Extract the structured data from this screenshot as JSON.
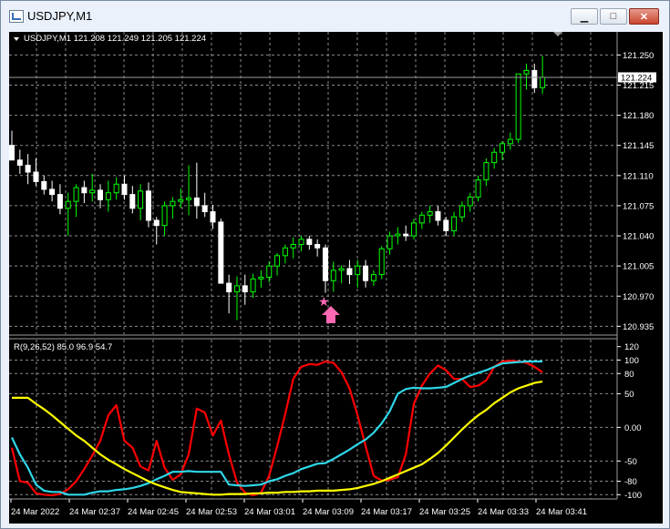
{
  "window": {
    "title": "USDJPY,M1",
    "minimize": "▁",
    "maximize": "□",
    "close": "✕"
  },
  "colors": {
    "background": "#000000",
    "grid": "#8a8a8a",
    "bull": "#00ff00",
    "bear": "#ffffff",
    "arrow": "#ff69b4",
    "red": "#ff0000",
    "cyan": "#2fd7e8",
    "yellow": "#ffff00",
    "currentPrice": "#ffffff"
  },
  "icons": {
    "collapse": "triangle-down-icon",
    "signal_star": "star-icon",
    "signal_arrow": "up-arrow-icon"
  },
  "main": {
    "header": "USDJPY,M1  121.208 121.249 121.205 121.224",
    "current_price": "121.224",
    "price_min": 120.928,
    "price_max": 121.262
  },
  "chart_data": [
    {
      "type": "candlestick",
      "price_ticks": [
        "121.250",
        "121.215",
        "121.180",
        "121.145",
        "121.110",
        "121.075",
        "121.040",
        "121.005",
        "120.970",
        "120.935"
      ],
      "candles": [
        [
          121.145,
          121.162,
          121.138,
          121.128
        ],
        [
          121.128,
          121.14,
          121.112,
          121.122
        ],
        [
          121.122,
          121.135,
          121.1,
          121.114
        ],
        [
          121.114,
          121.13,
          121.098,
          121.103
        ],
        [
          121.103,
          121.11,
          121.088,
          121.094
        ],
        [
          121.094,
          121.104,
          121.08,
          121.088
        ],
        [
          121.088,
          121.1,
          121.065,
          121.072
        ],
        [
          121.072,
          121.09,
          121.04,
          121.08
        ],
        [
          121.08,
          121.1,
          121.062,
          121.096
        ],
        [
          121.096,
          121.104,
          121.078,
          121.09
        ],
        [
          121.09,
          121.112,
          121.08,
          121.093
        ],
        [
          121.093,
          121.1,
          121.072,
          121.082
        ],
        [
          121.082,
          121.104,
          121.068,
          121.09
        ],
        [
          121.09,
          121.108,
          121.082,
          121.1
        ],
        [
          121.1,
          121.11,
          121.082,
          121.088
        ],
        [
          121.088,
          121.098,
          121.066,
          121.072
        ],
        [
          121.072,
          121.1,
          121.058,
          121.092
        ],
        [
          121.092,
          121.102,
          121.05,
          121.058
        ],
        [
          121.058,
          121.062,
          121.03,
          121.052
        ],
        [
          121.052,
          121.08,
          121.04,
          121.075
        ],
        [
          121.075,
          121.085,
          121.06,
          121.08
        ],
        [
          121.08,
          121.095,
          121.072,
          121.082
        ],
        [
          121.082,
          121.122,
          121.064,
          121.084
        ],
        [
          121.084,
          121.125,
          121.06,
          121.075
        ],
        [
          121.075,
          121.09,
          121.062,
          121.068
        ],
        [
          121.068,
          121.076,
          121.048,
          121.056
        ],
        [
          121.056,
          121.06,
          120.99,
          120.985
        ],
        [
          120.985,
          120.995,
          120.95,
          120.975
        ],
        [
          120.975,
          120.993,
          120.942,
          120.982
        ],
        [
          120.982,
          120.995,
          120.96,
          120.975
        ],
        [
          120.975,
          120.996,
          120.968,
          120.99
        ],
        [
          120.99,
          121.0,
          120.98,
          120.992
        ],
        [
          120.992,
          121.01,
          120.986,
          121.005
        ],
        [
          121.005,
          121.02,
          120.994,
          121.017
        ],
        [
          121.017,
          121.03,
          121.008,
          121.026
        ],
        [
          121.026,
          121.038,
          121.014,
          121.03
        ],
        [
          121.03,
          121.04,
          121.022,
          121.036
        ],
        [
          121.036,
          121.04,
          121.024,
          121.03
        ],
        [
          121.03,
          121.036,
          121.016,
          121.026
        ],
        [
          121.026,
          121.03,
          120.974,
          120.988
        ],
        [
          120.988,
          121.01,
          120.975,
          121.0
        ],
        [
          121.0,
          121.006,
          120.985,
          121.002
        ],
        [
          121.002,
          121.012,
          120.984,
          120.995
        ],
        [
          120.995,
          121.012,
          120.98,
          121.005
        ],
        [
          121.005,
          121.012,
          120.98,
          120.988
        ],
        [
          120.988,
          121.0,
          120.982,
          120.995
        ],
        [
          120.995,
          121.028,
          120.99,
          121.025
        ],
        [
          121.025,
          121.045,
          121.018,
          121.04
        ],
        [
          121.04,
          121.05,
          121.03,
          121.042
        ],
        [
          121.042,
          121.052,
          121.034,
          121.04
        ],
        [
          121.04,
          121.06,
          121.036,
          121.055
        ],
        [
          121.055,
          121.068,
          121.048,
          121.064
        ],
        [
          121.064,
          121.075,
          121.055,
          121.068
        ],
        [
          121.068,
          121.075,
          121.052,
          121.058
        ],
        [
          121.058,
          121.062,
          121.04,
          121.046
        ],
        [
          121.046,
          121.068,
          121.04,
          121.062
        ],
        [
          121.062,
          121.08,
          121.056,
          121.075
        ],
        [
          121.075,
          121.09,
          121.068,
          121.085
        ],
        [
          121.085,
          121.11,
          121.08,
          121.105
        ],
        [
          121.105,
          121.13,
          121.098,
          121.125
        ],
        [
          121.125,
          121.142,
          121.118,
          121.137
        ],
        [
          121.137,
          121.15,
          121.128,
          121.147
        ],
        [
          121.147,
          121.16,
          121.14,
          121.152
        ],
        [
          121.152,
          121.215,
          121.148,
          121.228
        ],
        [
          121.228,
          121.24,
          121.21,
          121.232
        ],
        [
          121.232,
          121.24,
          121.206,
          121.212
        ],
        [
          121.212,
          121.249,
          121.205,
          121.224
        ]
      ],
      "signal": {
        "candle": 39,
        "price": 120.965
      }
    },
    {
      "type": "line",
      "label": "R(9,26,52) 85.0 96.9 54.7",
      "ylim": [
        -105,
        125
      ],
      "ticks": [
        "120",
        "100",
        "80",
        "50",
        "0.00",
        "-50",
        "-80",
        "-100"
      ],
      "tick_values": [
        120,
        100,
        80,
        50,
        0,
        -50,
        -80,
        -100
      ],
      "series": [
        {
          "color": "red",
          "values": [
            -30,
            -80,
            -82,
            -98,
            -100,
            -101,
            -99,
            -92,
            -80,
            -62,
            -42,
            -20,
            18,
            33,
            -20,
            -30,
            -58,
            -64,
            -20,
            -60,
            -78,
            -70,
            -40,
            28,
            22,
            -12,
            10,
            -40,
            -82,
            -97,
            -101,
            -97,
            -72,
            -28,
            20,
            72,
            90,
            94,
            93,
            98,
            96,
            82,
            58,
            18,
            -28,
            -72,
            -79,
            -78,
            -74,
            -40,
            35,
            62,
            80,
            92,
            85,
            72,
            72,
            60,
            62,
            70,
            90,
            98,
            99,
            98,
            96,
            90,
            82
          ]
        },
        {
          "color": "cyan",
          "values": [
            -15,
            -40,
            -60,
            -85,
            -94,
            -96,
            -96,
            -100,
            -100,
            -100,
            -97,
            -95,
            -95,
            -93,
            -92,
            -90,
            -87,
            -83,
            -77,
            -72,
            -66,
            -66,
            -65,
            -66,
            -66,
            -66,
            -66,
            -85,
            -86,
            -87,
            -86,
            -85,
            -80,
            -77,
            -72,
            -68,
            -62,
            -58,
            -54,
            -53,
            -47,
            -40,
            -33,
            -25,
            -18,
            -8,
            6,
            24,
            50,
            57,
            59,
            58,
            58,
            59,
            60,
            66,
            72,
            77,
            81,
            85,
            90,
            95,
            96,
            97,
            98,
            98,
            98
          ]
        },
        {
          "color": "yellow",
          "values": [
            44,
            44,
            44,
            35,
            27,
            18,
            8,
            -2,
            -12,
            -20,
            -30,
            -40,
            -48,
            -55,
            -62,
            -68,
            -74,
            -80,
            -85,
            -89,
            -93,
            -96,
            -97,
            -98,
            -99,
            -100,
            -100,
            -99,
            -99,
            -99,
            -98,
            -98,
            -97,
            -97,
            -96,
            -96,
            -95,
            -95,
            -94,
            -94,
            -94,
            -93,
            -92,
            -90,
            -87,
            -84,
            -80,
            -75,
            -70,
            -65,
            -60,
            -55,
            -47,
            -38,
            -27,
            -15,
            -3,
            8,
            18,
            26,
            36,
            44,
            52,
            58,
            62,
            66,
            68
          ]
        }
      ]
    }
  ],
  "time_labels": [
    "24 Mar 2022",
    "24 Mar 02:37",
    "24 Mar 02:45",
    "24 Mar 02:53",
    "24 Mar 03:01",
    "24 Mar 03:09",
    "24 Mar 03:17",
    "24 Mar 03:25",
    "24 Mar 03:33",
    "24 Mar 03:41"
  ]
}
